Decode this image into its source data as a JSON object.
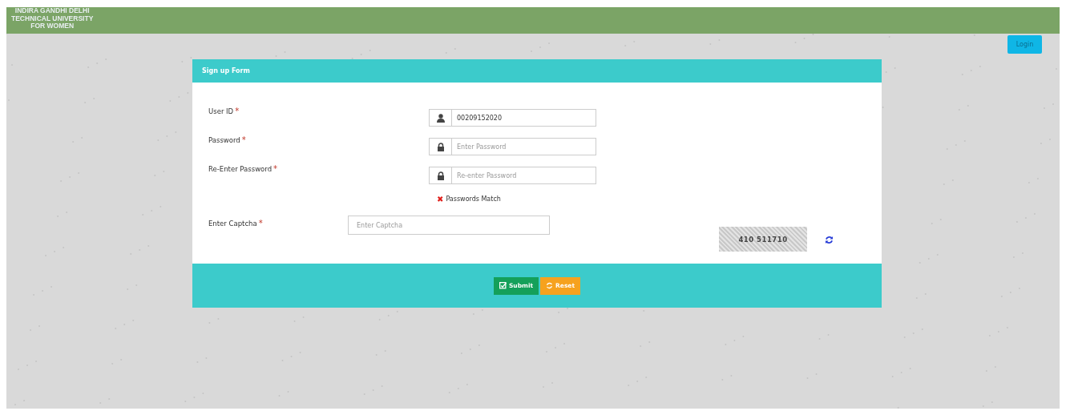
{
  "header": {
    "title_lines": [
      "INDIRA GANDHI DELHI",
      "TECHNICAL UNIVERSITY",
      "FOR WOMEN"
    ]
  },
  "login_button": "Login",
  "form": {
    "title": "Sign up Form",
    "fields": [
      {
        "label": "User ID",
        "required_mark": "*",
        "value": "00209152020"
      },
      {
        "label": "Password",
        "required_mark": "*",
        "placeholder": "Enter Password"
      },
      {
        "label": "Re-Enter Password",
        "required_mark": "*",
        "placeholder": "Re-enter Password"
      }
    ],
    "match_status": {
      "mark": "✖",
      "text": "Passwords Match"
    },
    "captcha": {
      "label": "Enter Captcha",
      "required_mark": "*",
      "placeholder": "Enter Captcha",
      "code": "410 511710"
    },
    "buttons": [
      {
        "kind": "submit",
        "label": "Submit"
      },
      {
        "kind": "reset",
        "label": "Reset"
      }
    ]
  }
}
